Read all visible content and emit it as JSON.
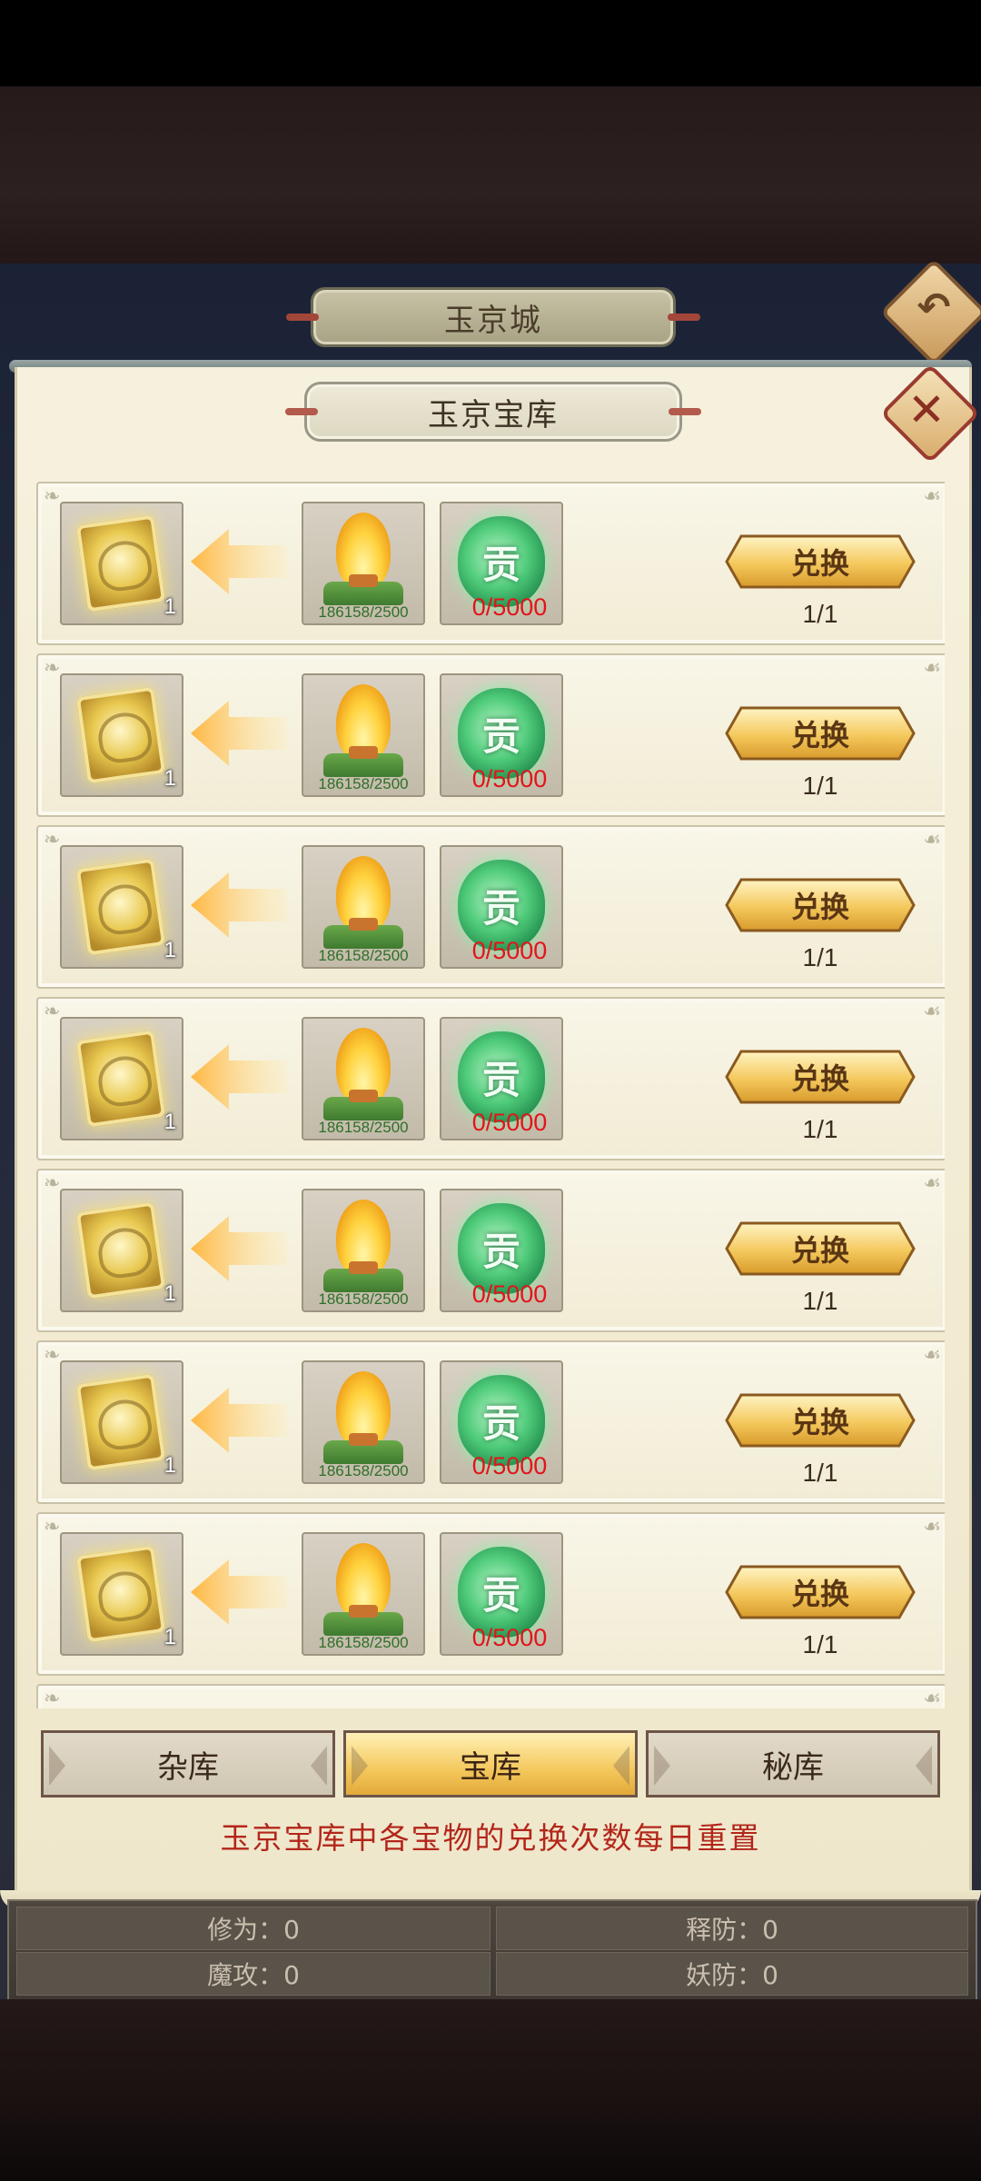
{
  "city_title": "玉京城",
  "treasury_title": "玉京宝库",
  "icons": {
    "back": "back-arrow-icon",
    "close": "close-icon",
    "reward": "golden-book-icon",
    "fire": "golden-flame-icon",
    "jade": "jade-contribution-icon",
    "arrow": "exchange-arrow-icon"
  },
  "items": [
    {
      "reward_count": "1",
      "fire_cost": "186158/2500",
      "jade_cost": "0/5000",
      "button": "兑换",
      "limit": "1/1"
    },
    {
      "reward_count": "1",
      "fire_cost": "186158/2500",
      "jade_cost": "0/5000",
      "button": "兑换",
      "limit": "1/1"
    },
    {
      "reward_count": "1",
      "fire_cost": "186158/2500",
      "jade_cost": "0/5000",
      "button": "兑换",
      "limit": "1/1"
    },
    {
      "reward_count": "1",
      "fire_cost": "186158/2500",
      "jade_cost": "0/5000",
      "button": "兑换",
      "limit": "1/1"
    },
    {
      "reward_count": "1",
      "fire_cost": "186158/2500",
      "jade_cost": "0/5000",
      "button": "兑换",
      "limit": "1/1"
    },
    {
      "reward_count": "1",
      "fire_cost": "186158/2500",
      "jade_cost": "0/5000",
      "button": "兑换",
      "limit": "1/1"
    },
    {
      "reward_count": "1",
      "fire_cost": "186158/2500",
      "jade_cost": "0/5000",
      "button": "兑换",
      "limit": "1/1"
    }
  ],
  "jade_char": "贡",
  "tabs": [
    {
      "label": "杂库",
      "active": false
    },
    {
      "label": "宝库",
      "active": true
    },
    {
      "label": "秘库",
      "active": false
    }
  ],
  "notice": "玉京宝库中各宝物的兑换次数每日重置",
  "stats": {
    "cultivation": "修为：0",
    "spell_defense": "释防：0",
    "magic_attack": "魔攻：0",
    "demon_defense": "妖防：0"
  },
  "colors": {
    "accent_gold": "#f4c85c",
    "cost_red": "#e2141b",
    "cost_green": "#2f6f2a",
    "notice_red": "#b3261b"
  }
}
